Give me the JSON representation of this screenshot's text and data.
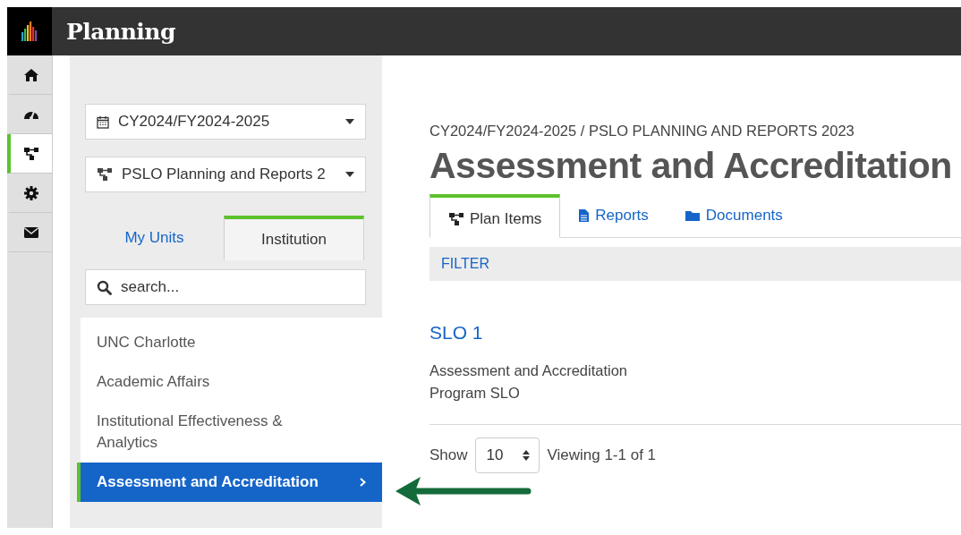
{
  "app": {
    "title": "Planning"
  },
  "rail": [
    {
      "kind": "home",
      "selected": false
    },
    {
      "kind": "gauge",
      "selected": false
    },
    {
      "kind": "sitemap",
      "selected": true
    },
    {
      "kind": "gear",
      "selected": false
    },
    {
      "kind": "mail",
      "selected": false
    }
  ],
  "sidebar": {
    "year_select": {
      "value": "CY2024/FY2024-2025"
    },
    "plan_select": {
      "value": "PSLO Planning and Reports 2"
    },
    "tabs": [
      {
        "label": "My Units",
        "selected": false
      },
      {
        "label": "Institution",
        "selected": true
      }
    ],
    "search": {
      "placeholder": "search..."
    },
    "units": [
      {
        "label": "UNC Charlotte",
        "selected": false
      },
      {
        "label": "Academic Affairs",
        "selected": false
      },
      {
        "label": "Institutional Effectiveness & Analytics",
        "selected": false
      },
      {
        "label": "Assessment and Accreditation",
        "selected": true
      }
    ]
  },
  "main": {
    "breadcrumb": "CY2024/FY2024-2025 / PSLO PLANNING AND REPORTS 2023",
    "heading": "Assessment and Accreditation",
    "tabs": [
      {
        "label": "Plan Items",
        "kind": "sitemap",
        "selected": true
      },
      {
        "label": "Reports",
        "kind": "file",
        "selected": false
      },
      {
        "label": "Documents",
        "kind": "folder",
        "selected": false
      }
    ],
    "filter": "FILTER",
    "items": [
      {
        "title": "SLO 1",
        "lines": [
          "Assessment and Accreditation",
          "Program SLO"
        ]
      }
    ],
    "pager": {
      "show": "Show",
      "page_size": "10",
      "viewing": "Viewing 1-1 of 1"
    }
  }
}
